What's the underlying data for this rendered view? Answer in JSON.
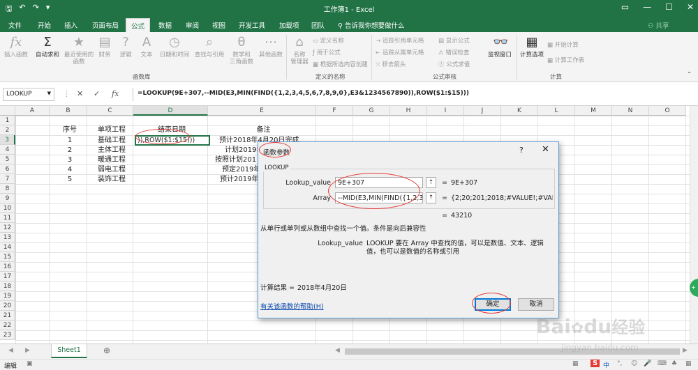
{
  "window": {
    "title": "工作簿1 - Excel"
  },
  "ribbon_tabs": [
    "文件",
    "开始",
    "插入",
    "页面布局",
    "公式",
    "数据",
    "审阅",
    "视图",
    "开发工具",
    "加载项",
    "团队"
  ],
  "active_tab": "公式",
  "tell_me": "告诉我你想要做什么",
  "share": "共享",
  "ribbon": {
    "insert_function": "插入函数",
    "autosum": "自动求和",
    "recent": "最近使用的\n函数",
    "financial": "财务",
    "logical": "逻辑",
    "text": "文本",
    "datetime": "日期和时间",
    "lookup": "查找与引用",
    "math": "数学和\n三角函数",
    "other": "其他函数",
    "group_library": "函数库",
    "name_manager": "名称\n管理器",
    "define_name": "定义名称",
    "use_in_formula": "用于公式",
    "create_from_selection": "根据所选内容创建",
    "group_names": "定义的名称",
    "trace_precedents": "追踪引用单元格",
    "trace_dependents": "追踪从属单元格",
    "remove_arrows": "移去箭头",
    "show_formulas": "显示公式",
    "error_checking": "错误检查",
    "evaluate_formula": "公式求值",
    "group_audit": "公式审核",
    "watch_window": "监视窗口",
    "calc_options": "计算选项",
    "calc_now": "开始计算",
    "calc_sheet": "计算工作表",
    "group_calc": "计算"
  },
  "formula_bar": {
    "name_box": "LOOKUP",
    "formula": "=LOOKUP(9E+307,--MID(E3,MIN(FIND({1,2,3,4,5,6,7,8,9,0},E3&1234567890)),ROW($1:$15)))"
  },
  "columns": [
    "A",
    "B",
    "C",
    "D",
    "E",
    "F",
    "G",
    "H",
    "I",
    "J",
    "K",
    "L",
    "M",
    "N",
    "O"
  ],
  "rows": [
    "1",
    "2",
    "3",
    "4",
    "5",
    "6",
    "7",
    "8",
    "9",
    "10",
    "11",
    "12",
    "13",
    "14",
    "15",
    "16",
    "17",
    "18",
    "19",
    "20",
    "21",
    "22",
    "23"
  ],
  "sheet": {
    "headers": {
      "B": "序号",
      "C": "单项工程",
      "D": "结束日期",
      "E": "备注"
    },
    "data": [
      {
        "no": "1",
        "name": "基础工程",
        "note": "预计2018年4月20日完成"
      },
      {
        "no": "2",
        "name": "主体工程",
        "note": "计划2019年"
      },
      {
        "no": "3",
        "name": "暖通工程",
        "note": "按照计划201"
      },
      {
        "no": "4",
        "name": "弱电工程",
        "note": "预定2019年"
      },
      {
        "no": "5",
        "name": "装饰工程",
        "note": "预计2019年"
      }
    ],
    "active_cell_text": ")),ROW($1:$15)))"
  },
  "dialog": {
    "title": "函数参数",
    "help_glyph": "?",
    "close_glyph": "✕",
    "function_name": "LOOKUP",
    "args": [
      {
        "label": "Lookup_value",
        "value": "9E+307",
        "result": "9E+307"
      },
      {
        "label": "Array",
        "value": "--MID(E3,MIN(FIND({1,2,3,4,5,",
        "result": "{2;20;201;2018;#VALUE!;#VALUE!..."
      }
    ],
    "equals": "=",
    "formula_result_preview": "43210",
    "description": "从单行或单列或从数组中查找一个值。条件是向后兼容性",
    "arg_desc_label": "Lookup_value",
    "arg_desc_text": "LOOKUP 要在 Array 中查找的值，可以是数值、文本、逻辑值，也可以是数值的名称或引用",
    "calc_result_label": "计算结果 =",
    "calc_result_value": "2018年4月20日",
    "help_link": "有关该函数的帮助(H)",
    "ok": "确定",
    "cancel": "取消"
  },
  "sheet_tabs": [
    "Sheet1"
  ],
  "status": {
    "mode": "编辑"
  },
  "colors": {
    "excel_green": "#217346",
    "dialog_border": "#5b9bd5",
    "annotation_red": "#e53935"
  },
  "watermark": {
    "brand": "Bai",
    "brand2": "du",
    "cn": "经验",
    "url": "jingyan.baidu.com"
  }
}
